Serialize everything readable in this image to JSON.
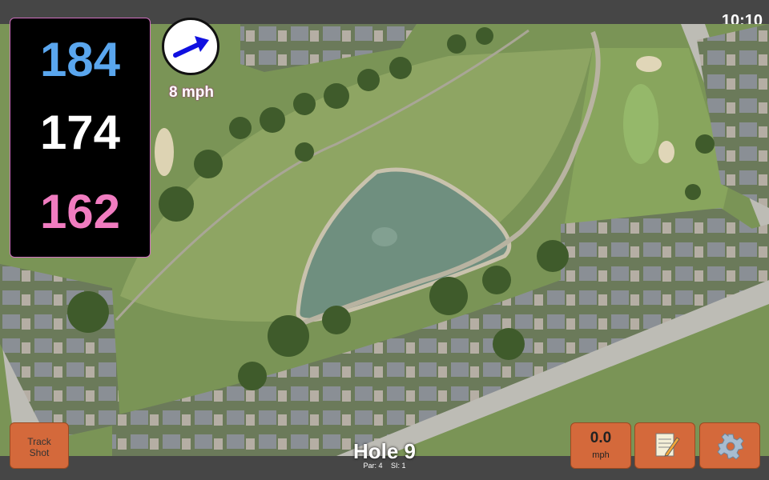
{
  "clock": "10:10",
  "distances": {
    "back": "184",
    "middle": "174",
    "front": "162"
  },
  "wind": {
    "speed": "8 mph",
    "arrow_icon": "wind-direction-arrow-icon",
    "arrow_color": "#1010e0"
  },
  "buttons": {
    "track_shot": [
      "Track",
      "Shot"
    ],
    "speed_value": "0.0",
    "speed_unit": "mph",
    "notes_icon": "notepad-icon",
    "settings_icon": "gear-icon"
  },
  "hole": {
    "title": "Hole 9",
    "par": "Par: 4",
    "si": "SI: 1"
  },
  "colors": {
    "back": "#5aa6ee",
    "middle": "#ffffff",
    "front": "#f07cc0",
    "button": "#d4693b"
  }
}
